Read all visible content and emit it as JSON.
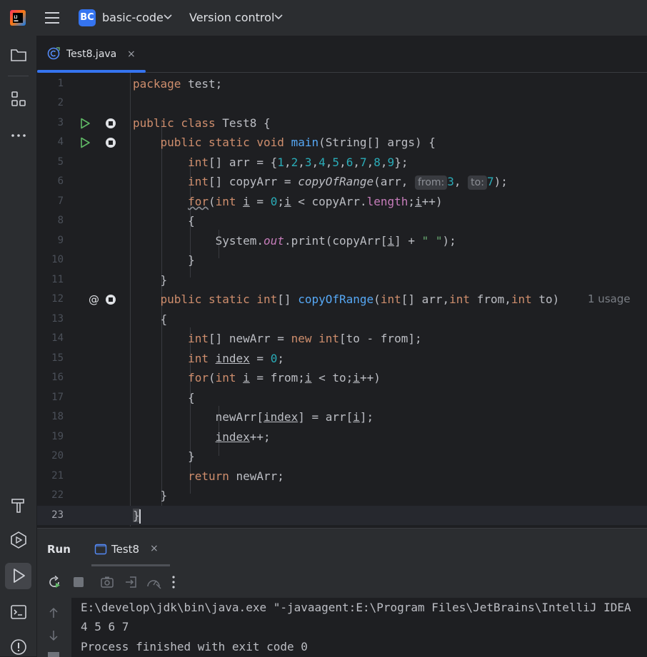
{
  "topbar": {
    "project_badge": "BC",
    "project_name": "basic-code",
    "vcs_label": "Version control"
  },
  "editor_tab": {
    "label": "Test8.java",
    "close": "×"
  },
  "code_lines": [
    {
      "n": "1"
    },
    {
      "n": "2"
    },
    {
      "n": "3"
    },
    {
      "n": "4"
    },
    {
      "n": "5"
    },
    {
      "n": "6"
    },
    {
      "n": "7"
    },
    {
      "n": "8"
    },
    {
      "n": "9"
    },
    {
      "n": "10"
    },
    {
      "n": "11"
    },
    {
      "n": "12"
    },
    {
      "n": "13"
    },
    {
      "n": "14"
    },
    {
      "n": "15"
    },
    {
      "n": "16"
    },
    {
      "n": "17"
    },
    {
      "n": "18"
    },
    {
      "n": "19"
    },
    {
      "n": "20"
    },
    {
      "n": "21"
    },
    {
      "n": "22"
    },
    {
      "n": "23"
    }
  ],
  "code": {
    "l1_kw": "package",
    "l1_rest": " test;",
    "l3_kw": "public class",
    "l3_rest": " Test8 {",
    "l4_kw1": "public static void",
    "l4_fn": "main",
    "l4_rest": "(String[] args) {",
    "l5_kw": "int",
    "l5_a": "[] arr = {",
    "l5_nums": [
      "1",
      "2",
      "3",
      "4",
      "5",
      "6",
      "7",
      "8",
      "9"
    ],
    "l5_end": "};",
    "l6_kw": "int",
    "l6_a": "[] copyArr = ",
    "l6_call": "copyOfRange",
    "l6_b": "(arr, ",
    "l6_hint_from": "from:",
    "l6_n1": "3",
    "l6_c": ", ",
    "l6_hint_to": "to:",
    "l6_n2": "7",
    "l6_end": ");",
    "l7_for": "for",
    "l7_a": "(",
    "l7_int": "int",
    "l7_i": "i",
    "l7_eq": " = ",
    "l7_zero": "0",
    "l7_semi": ";",
    "l7_i2": "i",
    "l7_lt": " < copyArr.",
    "l7_len": "length",
    "l7_semi2": ";",
    "l7_i3": "i",
    "l7_end": "++)",
    "l8": "{",
    "l9_a": "System.",
    "l9_out": "out",
    "l9_b": ".print(copyArr[",
    "l9_i": "i",
    "l9_c": "] + ",
    "l9_str": "\" \"",
    "l9_end": ");",
    "l10": "}",
    "l11": "}",
    "l12_kw": "public static int",
    "l12_a": "[] ",
    "l12_fn": "copyOfRange",
    "l12_b": "(",
    "l12_int1": "int",
    "l12_c": "[] arr,",
    "l12_int2": "int",
    "l12_d": " from,",
    "l12_int3": "int",
    "l12_e": " to)",
    "l12_usage": "1 usage",
    "l13": "{",
    "l14_kw": "int",
    "l14_a": "[] newArr = ",
    "l14_new": "new int",
    "l14_b": "[to - from];",
    "l15_kw": "int",
    "l15_var": "index",
    "l15_a": " = ",
    "l15_zero": "0",
    "l15_end": ";",
    "l16_for": "for",
    "l16_a": "(",
    "l16_int": "int",
    "l16_i": "i",
    "l16_b": " = from;",
    "l16_i2": "i",
    "l16_c": " < to;",
    "l16_i3": "i",
    "l16_end": "++)",
    "l17": "{",
    "l18_a": "newArr[",
    "l18_idx": "index",
    "l18_b": "] = arr[",
    "l18_i": "i",
    "l18_end": "];",
    "l19_idx": "index",
    "l19_end": "++;",
    "l20": "}",
    "l21_kw": "return",
    "l21_rest": " newArr;",
    "l22": "}",
    "l23": "}"
  },
  "run_panel": {
    "title": "Run",
    "tab_label": "Test8",
    "tab_close": "×",
    "console": [
      "E:\\develop\\jdk\\bin\\java.exe \"-javaagent:E:\\Program Files\\JetBrains\\IntelliJ IDEA",
      "4 5 6 7",
      "Process finished with exit code 0"
    ]
  },
  "icons": [
    "intellij-logo-icon",
    "hamburger-menu-icon",
    "chevron-down-icon",
    "folder-icon",
    "structure-icon",
    "more-icon",
    "build-hammer-icon",
    "services-icon",
    "run-icon",
    "terminal-icon",
    "problems-icon",
    "java-class-icon",
    "run-gutter-icon",
    "debug-breakpoint-icon",
    "override-icon",
    "rerun-icon",
    "stop-icon",
    "camera-icon",
    "exit-icon",
    "settings-icon",
    "kebab-icon",
    "arrow-up-icon",
    "arrow-down-icon"
  ]
}
